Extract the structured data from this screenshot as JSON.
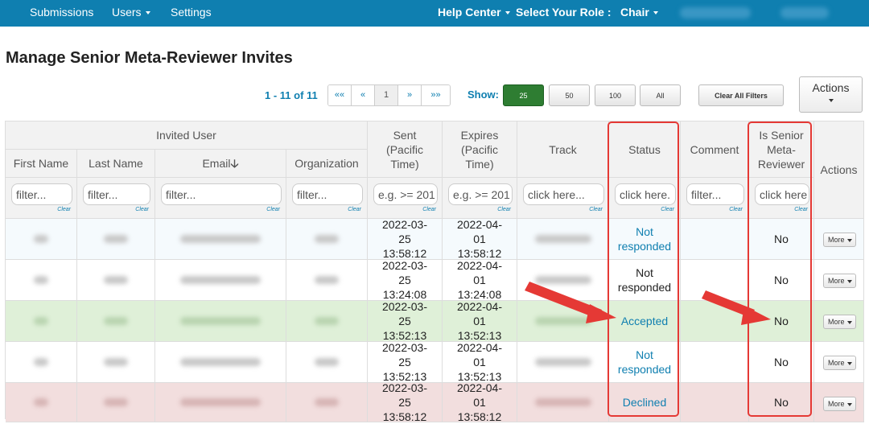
{
  "nav": {
    "submissions": "Submissions",
    "users": "Users",
    "settings": "Settings",
    "help": "Help Center",
    "role_label": "Select Your Role :",
    "role": "Chair"
  },
  "page": {
    "title": "Manage Senior Meta-Reviewer Invites"
  },
  "pager": {
    "count": "1 - 11 of 11",
    "first": "««",
    "prev": "«",
    "page": "1",
    "next": "»",
    "last": "»»"
  },
  "show": {
    "label": "Show:",
    "opt25": "25",
    "opt50": "50",
    "opt100": "100",
    "all": "All"
  },
  "buttons": {
    "clear_filters": "Clear All Filters",
    "actions": "Actions",
    "more": "More"
  },
  "table": {
    "group_header": "Invited User",
    "headers": {
      "first": "First Name",
      "last": "Last Name",
      "email": "Email",
      "org": "Organization",
      "sent": "Sent (Pacific Time)",
      "expires": "Expires (Pacific Time)",
      "track": "Track",
      "status": "Status",
      "comment": "Comment",
      "senior": "Is Senior Meta-Reviewer",
      "actions": "Actions"
    },
    "filters": {
      "first": "filter...",
      "last": "filter...",
      "email": "filter...",
      "org": "filter...",
      "sent": "e.g. >= 201",
      "expires": "e.g. >= 201",
      "track": "click here...",
      "status": "click here.",
      "comment": "filter...",
      "senior": "click here",
      "clear": "Clear"
    },
    "rows": [
      {
        "sent": "2022-03-25 13:58:12",
        "expires": "2022-04-01 13:58:12",
        "status": "Not responded",
        "senior": "No"
      },
      {
        "sent": "2022-03-25 13:24:08",
        "expires": "2022-04-01 13:24:08",
        "status": "Not responded",
        "senior": "No"
      },
      {
        "sent": "2022-03-25 13:52:13",
        "expires": "2022-04-01 13:52:13",
        "status": "Accepted",
        "senior": "No"
      },
      {
        "sent": "2022-03-25 13:52:13",
        "expires": "2022-04-01 13:52:13",
        "status": "Not responded",
        "senior": "No"
      },
      {
        "sent": "2022-03-25 13:58:12",
        "expires": "2022-04-01 13:58:12",
        "status": "Declined",
        "senior": "No"
      }
    ]
  },
  "colors": {
    "nav": "#0f7fb0",
    "accepted_row": "#dff0d8",
    "declined_row": "#f2dede",
    "annotation": "#e53935"
  }
}
